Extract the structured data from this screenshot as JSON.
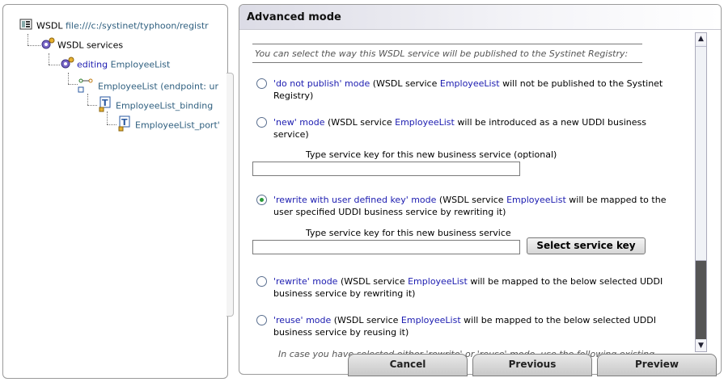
{
  "tree": {
    "wsdl_label": "WSDL",
    "wsdl_path": "file:///c:/systinet/typhoon/registr",
    "services_label": "WSDL services",
    "editing_prefix": "editing",
    "editing_name": "EmployeeList",
    "endpoint_label": "EmployeeList (endpoint: ur",
    "binding_label": "EmployeeList_binding",
    "port_label": "EmployeeList_port'"
  },
  "panel": {
    "title": "Advanced mode",
    "intro": "You can select the way this WSDL service will be published to the Systinet Registry:",
    "service_name": "EmployeeList",
    "options": [
      {
        "mode": "'do not publish' mode",
        "pre": " (WSDL service ",
        "post": " will not be published to the Systinet Registry)",
        "checked": false
      },
      {
        "mode": "'new' mode",
        "pre": " (WSDL service ",
        "post": " will be introduced as a new UDDI business service)",
        "checked": false
      },
      {
        "mode": "'rewrite with user defined key' mode",
        "pre": " (WSDL service ",
        "post": " will be mapped to the user specified UDDI business service by rewriting it)",
        "checked": true
      },
      {
        "mode": "'rewrite' mode",
        "pre": " (WSDL service ",
        "post": " will be mapped to the below selected UDDI business service by rewriting it)",
        "checked": false
      },
      {
        "mode": "'reuse' mode",
        "pre": " (WSDL service ",
        "post": " will be mapped to the below selected UDDI business service by reusing it)",
        "checked": false
      }
    ],
    "new_key_label": "Type service key for this new business service (optional)",
    "rewrite_key_label": "Type service key for this new business service",
    "select_key_button": "Select service key",
    "cut_note": "In case you have selected either 'rewrite' or 'reuse' mode, use the following existing"
  },
  "footer": {
    "cancel": "Cancel",
    "previous": "Previous",
    "preview": "Preview"
  },
  "scrollbar": {
    "up": "▲",
    "down": "▼"
  }
}
